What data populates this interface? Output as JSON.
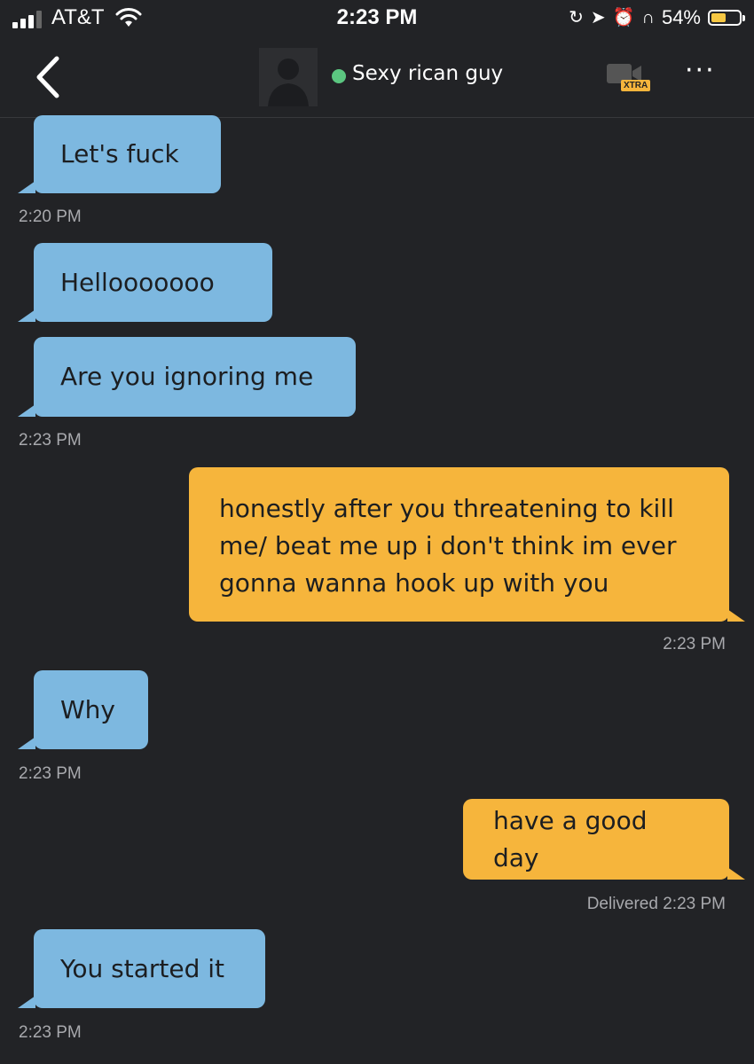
{
  "status_bar": {
    "carrier": "AT&T",
    "time": "2:23 PM",
    "battery_percent": "54%",
    "battery_level": 0.54,
    "icons": [
      "signal-icon",
      "wifi-icon",
      "rotation-lock-icon",
      "location-icon",
      "alarm-icon",
      "headphones-icon",
      "battery-icon"
    ]
  },
  "header": {
    "contact_name": "Sexy rican guy",
    "online_color": "#5bc680",
    "video_badge": "XTRA",
    "more_label": "···"
  },
  "messages": [
    {
      "dir": "in",
      "text": "Let's fuck",
      "timestamp": "2:20 PM"
    },
    {
      "dir": "in",
      "text": "Hellooooooo",
      "timestamp": ""
    },
    {
      "dir": "in",
      "text": "Are you ignoring me",
      "timestamp": "2:23 PM"
    },
    {
      "dir": "out",
      "lines": [
        "honestly after you threatening to kill",
        "me/ beat me up i don't think im ever",
        "gonna wanna hook up with you"
      ],
      "timestamp": "2:23 PM"
    },
    {
      "dir": "in",
      "text": "Why",
      "timestamp": "2:23 PM"
    },
    {
      "dir": "out",
      "text": "have a good day",
      "status": "Delivered",
      "timestamp": "2:23 PM"
    },
    {
      "dir": "in",
      "text": "You started it",
      "timestamp": "2:23 PM"
    }
  ],
  "colors": {
    "background": "#222326",
    "incoming_bubble": "#7db8e0",
    "outgoing_bubble": "#f6b53c"
  }
}
